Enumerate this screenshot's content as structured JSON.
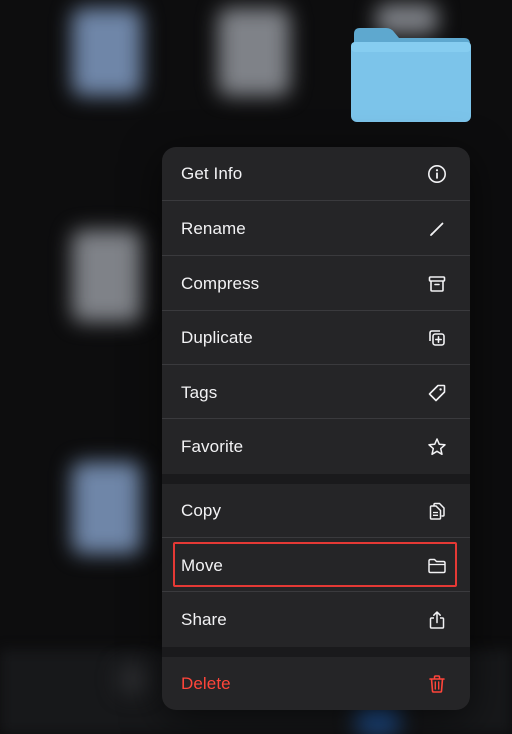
{
  "menu": {
    "items": [
      {
        "label": "Get Info",
        "icon": "info-circle-icon"
      },
      {
        "label": "Rename",
        "icon": "pencil-icon"
      },
      {
        "label": "Compress",
        "icon": "archive-box-icon"
      },
      {
        "label": "Duplicate",
        "icon": "duplicate-plus-icon"
      },
      {
        "label": "Tags",
        "icon": "tag-icon"
      },
      {
        "label": "Favorite",
        "icon": "star-icon"
      },
      {
        "label": "Copy",
        "icon": "copy-documents-icon"
      },
      {
        "label": "Move",
        "icon": "folder-icon"
      },
      {
        "label": "Share",
        "icon": "share-icon"
      },
      {
        "label": "Delete",
        "icon": "trash-icon"
      }
    ],
    "highlighted_item": "Move"
  },
  "colors": {
    "menu_bg": "#252527",
    "text": "#f2f2f4",
    "destructive": "#ff453a",
    "highlight_border": "#e53935",
    "folder_blue": "#7cc4ea"
  }
}
